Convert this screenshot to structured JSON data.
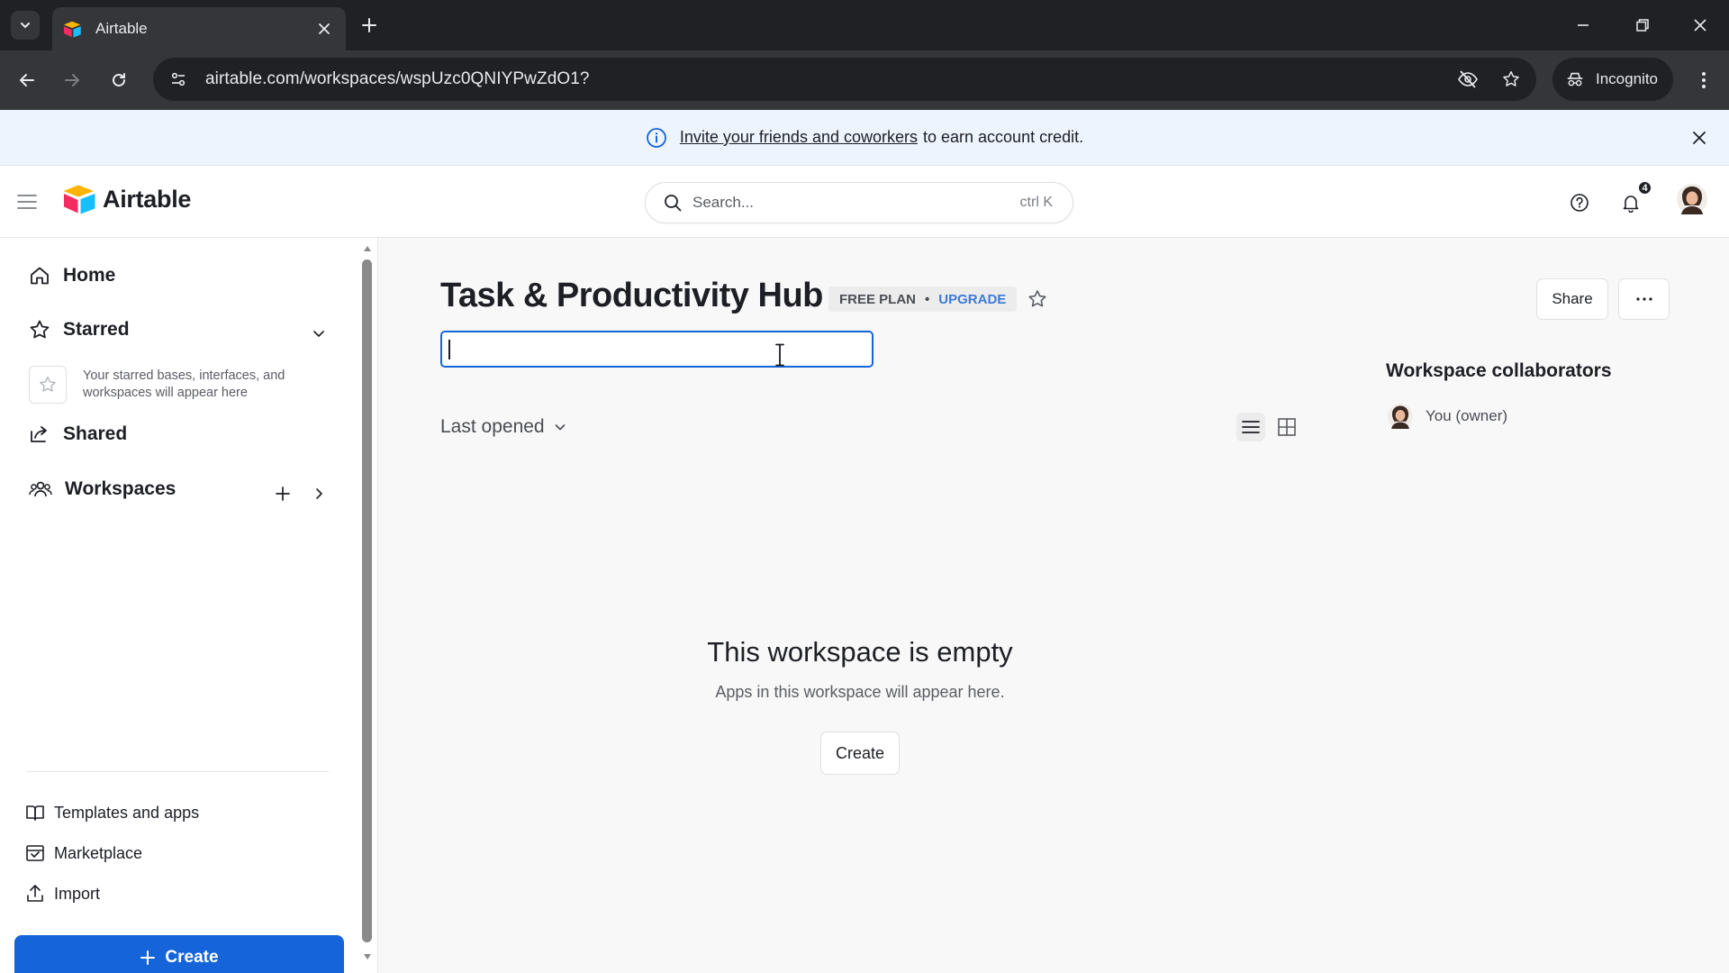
{
  "browser": {
    "tab_title": "Airtable",
    "url": "airtable.com/workspaces/wspUzc0QNIYPwZdO1?",
    "incognito_label": "Incognito"
  },
  "banner": {
    "link_text": "Invite your friends and coworkers",
    "rest_text": "to earn account credit."
  },
  "header": {
    "logo_text": "Airtable",
    "search_placeholder": "Search...",
    "search_shortcut": "ctrl K",
    "notification_count": "4"
  },
  "sidebar": {
    "home": "Home",
    "starred": "Starred",
    "starred_empty": "Your starred bases, interfaces, and workspaces will appear here",
    "shared": "Shared",
    "workspaces": "Workspaces",
    "templates": "Templates and apps",
    "marketplace": "Marketplace",
    "import": "Import",
    "create": "Create"
  },
  "main": {
    "title": "Task & Productivity Hub",
    "plan": "FREE PLAN",
    "plan_separator": "•",
    "upgrade": "UPGRADE",
    "rename_value": "",
    "sort_label": "Last opened",
    "share": "Share",
    "more": "···",
    "collaborators_title": "Workspace collaborators",
    "collaborator_name": "You (owner)",
    "empty_title": "This workspace is empty",
    "empty_sub": "Apps in this workspace will appear here.",
    "empty_create": "Create"
  },
  "colors": {
    "accent": "#1664d9",
    "banner_bg": "#eef4fd",
    "upgrade": "#3d7bd9"
  }
}
